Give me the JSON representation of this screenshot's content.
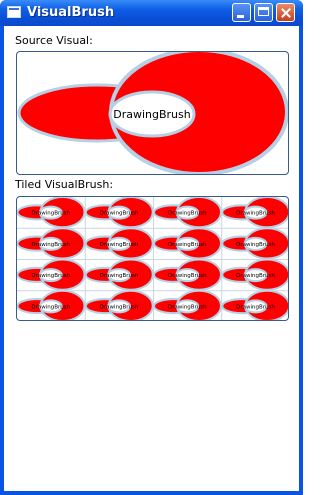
{
  "window": {
    "title": "VisualBrush",
    "buttons": {
      "minimize": "minimize",
      "maximize": "maximize",
      "close": "close"
    }
  },
  "labels": {
    "source_visual": "Source Visual:",
    "tiled_visualbrush": "Tiled VisualBrush:"
  },
  "source_visual": {
    "drawing_text": "DrawingBrush",
    "fill_color": "#ff0000",
    "stroke_color": "#b5cfe4",
    "background": "#ffffff"
  },
  "tiled": {
    "columns": 4,
    "rows": 4,
    "tile_text": "DrawingBrush"
  }
}
